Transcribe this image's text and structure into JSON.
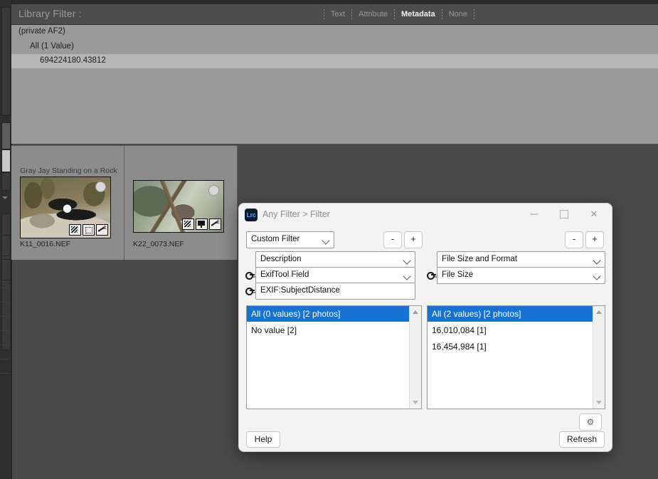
{
  "filter_bar": {
    "title": "Library Filter :",
    "tabs": [
      {
        "label": "Text",
        "active": false
      },
      {
        "label": "Attribute",
        "active": false
      },
      {
        "label": "Metadata",
        "active": true
      },
      {
        "label": "None",
        "active": false
      }
    ],
    "column_header": "(private AF2)",
    "rows": [
      {
        "label": "All (1 Value)",
        "selected": false
      },
      {
        "label": "694224180.43812",
        "selected": true
      }
    ]
  },
  "grid": {
    "cells": [
      {
        "caption": "Gray Jay Standing on a Rock",
        "filename": "K11_0016.NEF",
        "badges": [
          "keyword-badge",
          "crop-badge",
          "develop-badge"
        ]
      },
      {
        "caption": "",
        "filename": "K22_0073.NEF",
        "badges": [
          "keyword-badge",
          "flag-badge",
          "develop-badge"
        ]
      }
    ]
  },
  "dialog": {
    "app_icon": "Lrc",
    "title": "Any Filter > Filter",
    "window_controls": {
      "minimize": "minimize-icon",
      "maximize": "maximize-icon",
      "close": "close-icon"
    },
    "preset": {
      "value": "Custom Filter"
    },
    "left_column": {
      "stepper": {
        "minus": "-",
        "plus": "+"
      },
      "category": "Description",
      "field": "ExifTool Field",
      "tag_value": "EXIF:SubjectDistance",
      "list": [
        {
          "label": "All (0 values) [2 photos]",
          "selected": true
        },
        {
          "label": "No value [2]",
          "selected": false
        }
      ]
    },
    "right_column": {
      "stepper": {
        "minus": "-",
        "plus": "+"
      },
      "category": "File Size and Format",
      "field": "File Size",
      "list": [
        {
          "label": "All (2 values) [2 photos]",
          "selected": true
        },
        {
          "label": "16,010,084 [1]",
          "selected": false
        },
        {
          "label": "16,454,984 [1]",
          "selected": false
        }
      ]
    },
    "footer": {
      "help_label": "Help",
      "refresh_label": "Refresh",
      "settings_icon": "gear-icon"
    }
  },
  "colors": {
    "accent_selected": "#1673d1",
    "filter_panel_bg": "#999999",
    "app_bg": "#4a4a4a",
    "dialog_bg": "#f3f3f3"
  }
}
